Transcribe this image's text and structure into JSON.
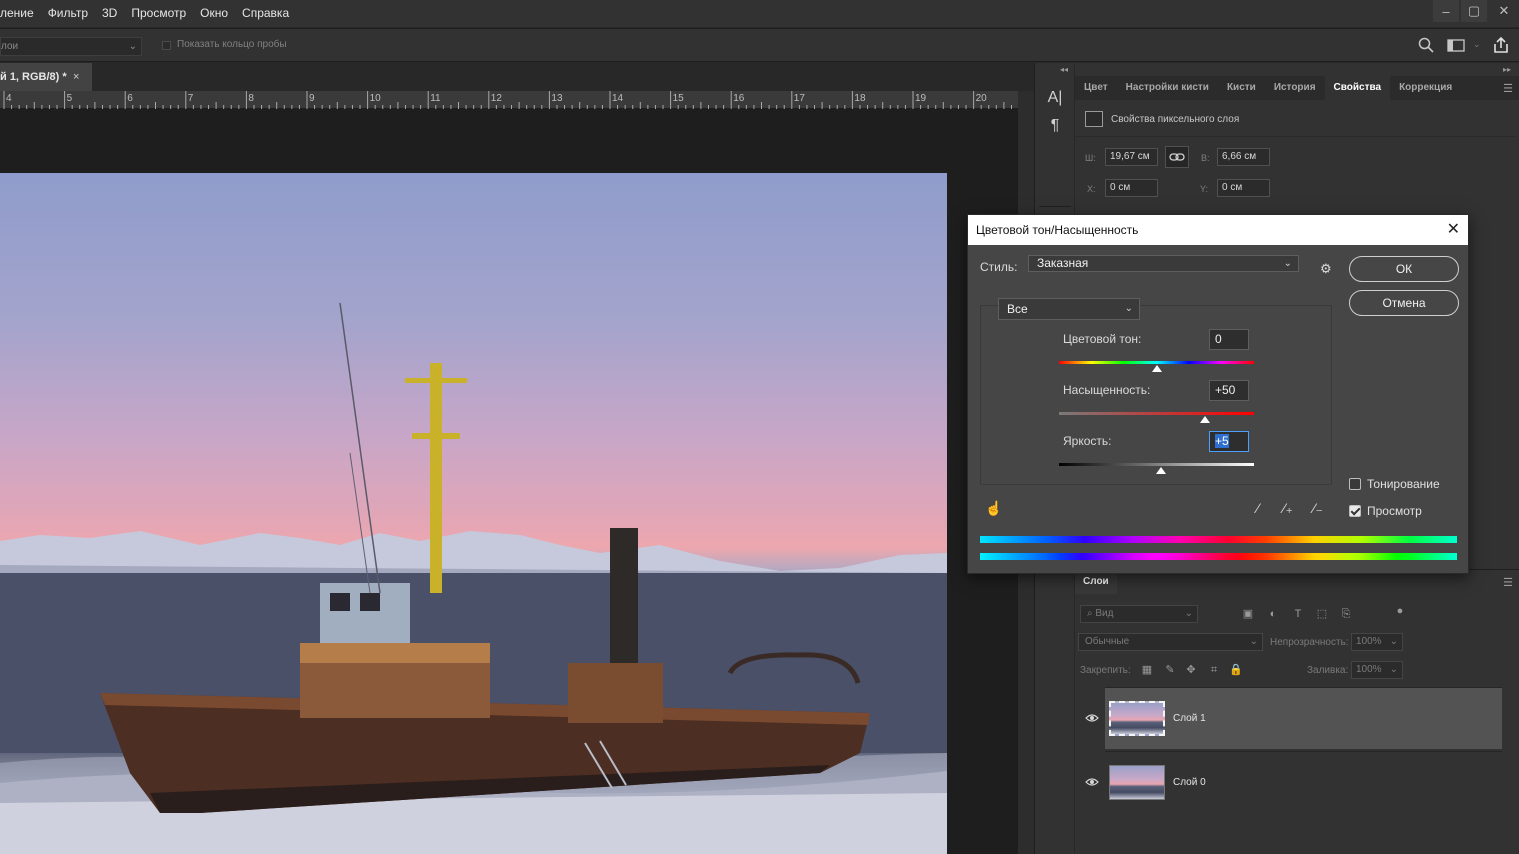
{
  "menu": [
    "ление",
    "Фильтр",
    "3D",
    "Просмотр",
    "Окно",
    "Справка"
  ],
  "window_controls": [
    "–",
    "▢",
    "✕"
  ],
  "options_bar": {
    "layer_select": "лои",
    "sample_ring_label": "Показать кольцо пробы"
  },
  "document_tab": {
    "title": "й 1, RGB/8) *",
    "close": "×"
  },
  "ruler": {
    "labels": [
      "4",
      "5",
      "6",
      "7",
      "8",
      "9",
      "10",
      "11",
      "12",
      "13",
      "14",
      "15",
      "16",
      "17",
      "18",
      "19",
      "20"
    ]
  },
  "side_tools": {
    "char_icon": "A|",
    "para_icon": "¶"
  },
  "panel_tabs": [
    "Цвет",
    "Настройки кисти",
    "Кисти",
    "История",
    "Свойства",
    "Коррекция"
  ],
  "active_panel_tab": "Свойства",
  "properties": {
    "title": "Свойства пиксельного слоя",
    "w_label": "Ш:",
    "w_value": "19,67 см",
    "h_label": "В:",
    "h_value": "6,66 см",
    "x_label": "X:",
    "x_value": "0 см",
    "y_label": "Y:",
    "y_value": "0 см"
  },
  "dialog": {
    "title": "Цветовой тон/Насыщенность",
    "style_label": "Стиль:",
    "style_value": "Заказная",
    "channel_value": "Все",
    "hue_label": "Цветовой тон:",
    "hue_value": "0",
    "saturation_label": "Насыщенность:",
    "saturation_value": "+50",
    "lightness_label": "Яркость:",
    "lightness_value": "+5",
    "ok_label": "ОК",
    "cancel_label": "Отмена",
    "colorize_label": "Тонирование",
    "colorize_checked": false,
    "preview_label": "Просмотр",
    "preview_checked": true,
    "hue_slider": 0.5,
    "saturation_slider": 0.75,
    "lightness_slider": 0.525
  },
  "layers_panel": {
    "tab": "Слои",
    "filter_label": "Вид",
    "blend_mode": "Обычные",
    "opacity_label": "Непрозрачность:",
    "opacity_value": "100%",
    "lock_label": "Закрепить:",
    "fill_label": "Заливка:",
    "fill_value": "100%",
    "layers": [
      {
        "name": "Слой 1",
        "selected": true
      },
      {
        "name": "Слой 0",
        "selected": false
      }
    ]
  },
  "colors": {
    "ui_dark": "#282828",
    "panel": "#323232",
    "dialog": "#464646",
    "accent": "#2f6fd0"
  }
}
